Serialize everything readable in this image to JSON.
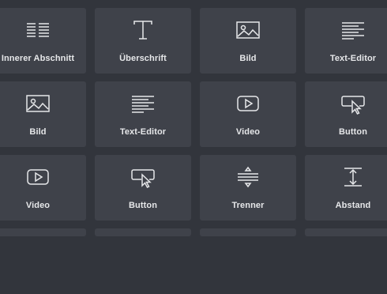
{
  "widgets": [
    {
      "label": "Innerer Abschnitt",
      "icon": "inner-section-icon"
    },
    {
      "label": "Überschrift",
      "icon": "heading-icon"
    },
    {
      "label": "Bild",
      "icon": "image-icon"
    },
    {
      "label": "Text-Editor",
      "icon": "text-editor-icon"
    },
    {
      "label": "Bild",
      "icon": "image-icon"
    },
    {
      "label": "Text-Editor",
      "icon": "text-editor-icon"
    },
    {
      "label": "Video",
      "icon": "video-icon"
    },
    {
      "label": "Button",
      "icon": "button-icon"
    },
    {
      "label": "Video",
      "icon": "video-icon"
    },
    {
      "label": "Button",
      "icon": "button-icon"
    },
    {
      "label": "Trenner",
      "icon": "divider-icon"
    },
    {
      "label": "Abstand",
      "icon": "spacer-icon"
    }
  ],
  "colors": {
    "background": "#32353c",
    "tile": "#3f424a",
    "text": "#e6e7e9"
  }
}
